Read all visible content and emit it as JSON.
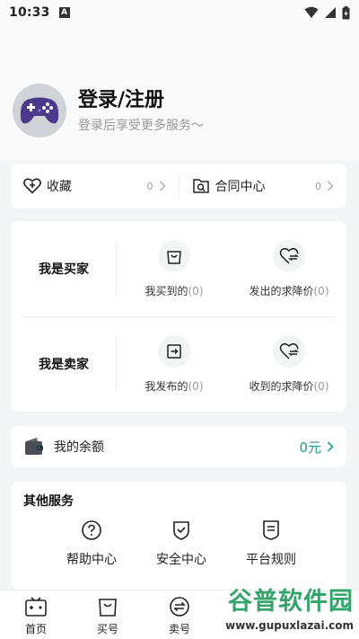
{
  "status_bar": {
    "time": "10:33",
    "notification_icon": "a-badge-icon",
    "signal": "wifi-icon",
    "cell": "cell-signal-icon",
    "battery": "battery-charging-icon"
  },
  "profile": {
    "title": "登录/注册",
    "subtitle": "登录后享受更多服务～",
    "avatar_icon": "gamepad-avatar-icon"
  },
  "quick_links": [
    {
      "label": "收藏",
      "count": "0",
      "icon": "heart-plus-icon"
    },
    {
      "label": "合同中心",
      "count": "0",
      "icon": "contract-search-icon"
    }
  ],
  "buyer": {
    "role": "我是买家",
    "items": [
      {
        "label": "我买到的",
        "count": "(0)",
        "icon": "shopping-bag-icon"
      },
      {
        "label": "发出的求降价",
        "count": "(0)",
        "icon": "heart-exchange-icon"
      }
    ]
  },
  "seller": {
    "role": "我是卖家",
    "items": [
      {
        "label": "我发布的",
        "count": "(0)",
        "icon": "publish-arrow-icon"
      },
      {
        "label": "收到的求降价",
        "count": "(0)",
        "icon": "heart-exchange-icon"
      }
    ]
  },
  "balance": {
    "label": "我的余额",
    "value": "0元",
    "icon": "wallet-icon"
  },
  "services": {
    "title": "其他服务",
    "items": [
      {
        "label": "帮助中心",
        "icon": "question-circle-icon"
      },
      {
        "label": "安全中心",
        "icon": "shield-check-icon"
      },
      {
        "label": "平台规则",
        "icon": "rules-doc-icon"
      }
    ]
  },
  "tabs": [
    {
      "label": "首页",
      "icon": "home-tv-icon"
    },
    {
      "label": "买号",
      "icon": "bag-tab-icon"
    },
    {
      "label": "卖号",
      "icon": "exchange-circle-icon"
    }
  ],
  "watermark": {
    "title": "谷普软件园",
    "url": "www.gupuxlazai.com"
  },
  "colors": {
    "accent": "#1f9c88",
    "background": "#f4f5f7",
    "watermark": "#33a56b"
  }
}
